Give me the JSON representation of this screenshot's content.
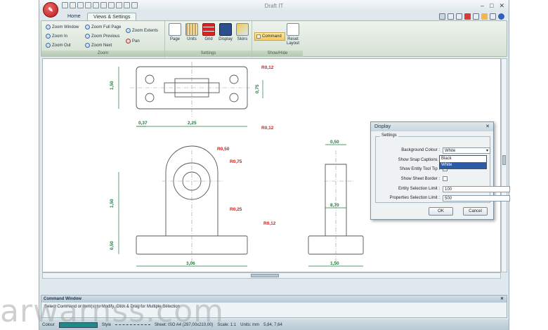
{
  "window": {
    "title": "Draft IT"
  },
  "tabs": [
    {
      "label": "Home"
    },
    {
      "label": "Views & Settings"
    }
  ],
  "ribbon": {
    "zoom": {
      "label": "Zoom",
      "items": [
        "Zoom Window",
        "Zoom Full Page",
        "Zoom Extents",
        "Zoom In",
        "Zoom Previous",
        "Pan",
        "Zoom Out",
        "Zoom Next"
      ]
    },
    "settings": {
      "label": "Settings",
      "items": [
        "Page",
        "Units",
        "Grid",
        "Display",
        "Skins"
      ]
    },
    "showhide": {
      "label": "Show/Hide",
      "command": "Command",
      "reset": "Reset Layout"
    }
  },
  "drawing": {
    "dims": [
      "R0,12",
      "1,50",
      "0,75",
      "R0,12",
      "0,37",
      "2,25",
      "R0,50",
      "R0,75",
      "1,50",
      "R0,25",
      "R0,12",
      "0,50",
      "3,06",
      "0,50",
      "8,70",
      "1,50"
    ]
  },
  "dialog": {
    "title": "Display",
    "group": "Settings",
    "fields": [
      {
        "label": "Background Colour :",
        "value": "White"
      },
      {
        "label": "Show Snap Captions :",
        "value": ""
      },
      {
        "label": "Show Entity Tool Tip :",
        "value": ""
      },
      {
        "label": "Show Sheet Border :",
        "value": ""
      },
      {
        "label": "Entity Selection Limit :",
        "value": "100"
      },
      {
        "label": "Properties Selection Limit :",
        "value": "500"
      }
    ],
    "dropdown_options": [
      "Black",
      "White"
    ],
    "ok": "OK",
    "cancel": "Cancel"
  },
  "command_window": {
    "title": "Command Window",
    "prompt": "Select Command or Item(s) to Modify, Click & Drag for Multiple Selection"
  },
  "status": {
    "colour_label": "Colour",
    "style_label": "Style",
    "sheet": "Sheet: ISO A4 (297,00x210,00)",
    "scale": "Scale: 1:1",
    "units": "Units: mm",
    "coords": "5,84, 7,64"
  },
  "watermark": "arwarnss.com",
  "colors": {
    "accent": "#2c5ba8",
    "ribbon": "#d5e2d3",
    "dim_red": "#cc1f1f",
    "dim_green": "#1f7a3a",
    "swatch": "#1e8a8a"
  }
}
